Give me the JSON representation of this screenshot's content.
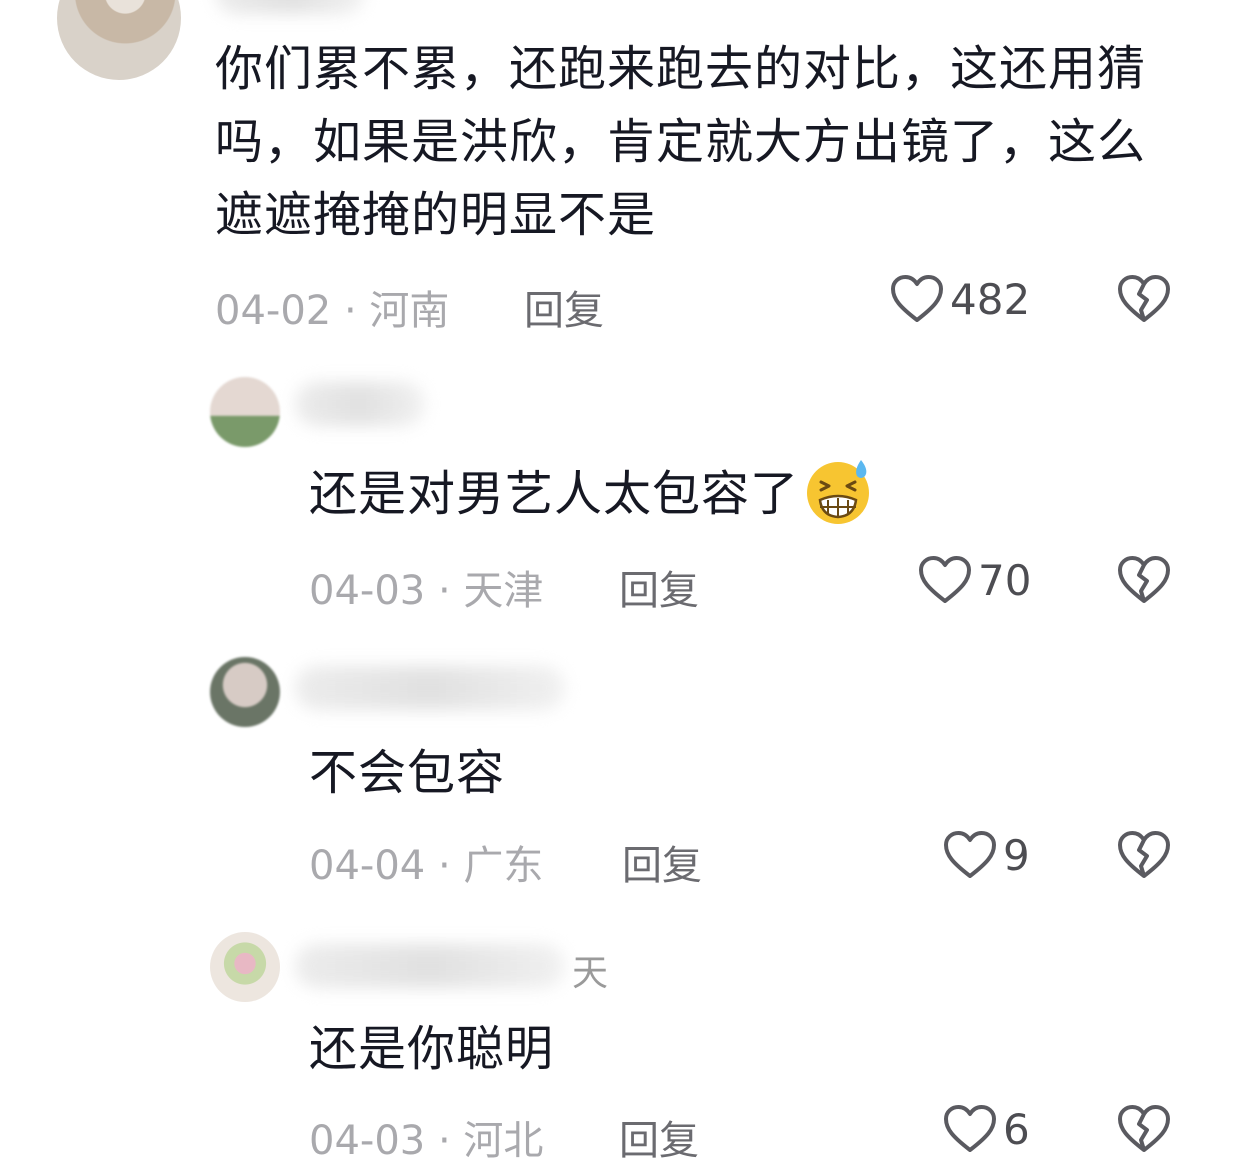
{
  "comments": [
    {
      "username_tail": "",
      "text_lines": [
        "你们累不累，还跑来跑去的对比，这还用猜",
        "吗，如果是洪欣，肯定就大方出镜了，这么",
        "遮遮掩掩的明显不是"
      ],
      "date": "04-02",
      "location": "河南",
      "reply_label": "回复",
      "likes": "482"
    },
    {
      "username_tail": "",
      "text": "还是对男艺人太包容了",
      "emoji": "grin-sweat-emoji",
      "date": "04-03",
      "location": "天津",
      "reply_label": "回复",
      "likes": "70"
    },
    {
      "username_tail": "",
      "text": "不会包容",
      "date": "04-04",
      "location": "广东",
      "reply_label": "回复",
      "likes": "9"
    },
    {
      "username_tail": "天",
      "text": "还是你聪明",
      "date": "04-03",
      "location": "河北",
      "reply_label": "回复",
      "likes": "6"
    }
  ],
  "meta_separator": " · ",
  "icons": {
    "like": "heart-outline-icon",
    "dislike": "broken-heart-icon"
  },
  "colors": {
    "text": "#161823",
    "meta": "#a9a9ad",
    "icon": "#5a5a60"
  }
}
